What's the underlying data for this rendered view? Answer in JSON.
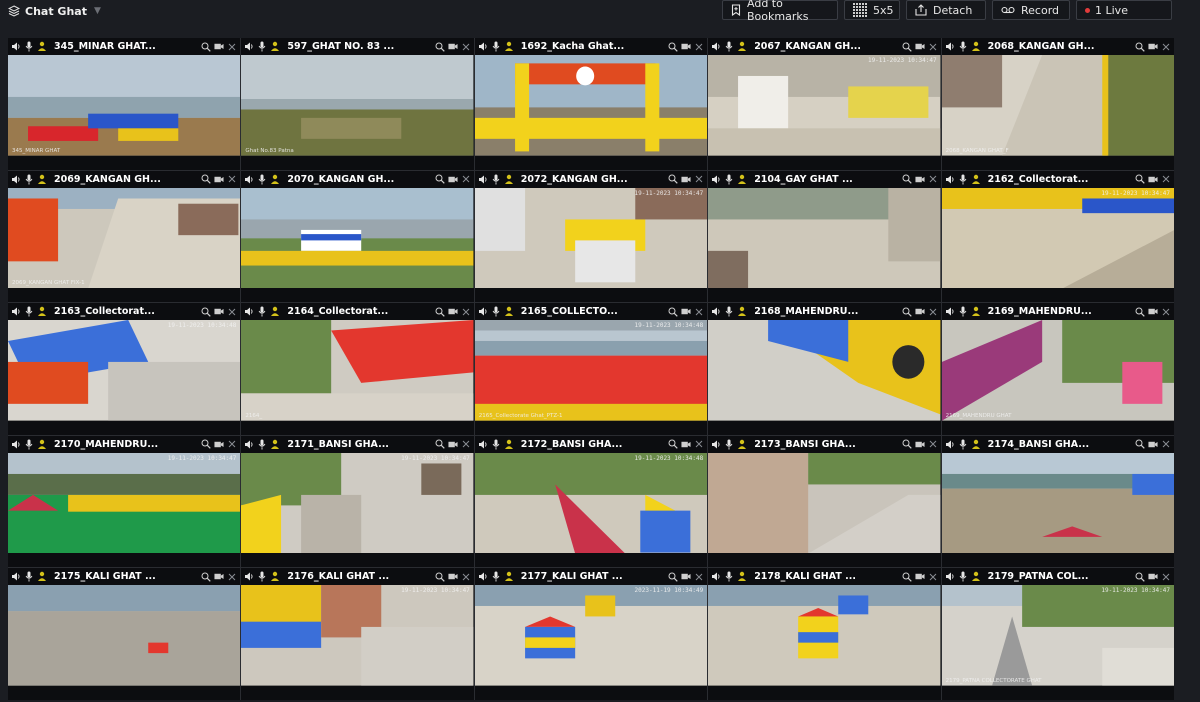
{
  "header": {
    "title": "Chat Ghat",
    "toolbar": {
      "bookmark_label": "Add to Bookmarks",
      "layout_label": "5x5",
      "detach_label": "Detach",
      "record_label": "Record",
      "live_label": "1 Live"
    }
  },
  "colors": {
    "background": "#1b1d22",
    "cell": "#0c0d10",
    "live_dot": "#e23b3b",
    "camera_icon_yellow": "#d4c21a"
  },
  "cameras": [
    {
      "name": "345_MINAR GHAT...",
      "label": "345_MINAR GHAT",
      "ts": ""
    },
    {
      "name": "597_GHAT NO. 83 ...",
      "label": "Ghat No.83 Patna",
      "ts": ""
    },
    {
      "name": "1692_Kacha Ghat...",
      "label": "",
      "ts": ""
    },
    {
      "name": "2067_KANGAN GH...",
      "label": "",
      "ts": "19-11-2023 10:34:47"
    },
    {
      "name": "2068_KANGAN GH...",
      "label": "2068_KANGAN GHAT_F",
      "ts": ""
    },
    {
      "name": "2069_KANGAN GH...",
      "label": "2069_KANGAN GHAT FIX-1",
      "ts": ""
    },
    {
      "name": "2070_KANGAN GH...",
      "label": "",
      "ts": ""
    },
    {
      "name": "2072_KANGAN GH...",
      "label": "",
      "ts": "19-11-2023 10:34:47"
    },
    {
      "name": "2104_GAY GHAT ...",
      "label": "",
      "ts": ""
    },
    {
      "name": "2162_Collectorat...",
      "label": "",
      "ts": "19-11-2023 10:34:47"
    },
    {
      "name": "2163_Collectorat...",
      "label": "",
      "ts": "19-11-2023 10:34:48"
    },
    {
      "name": "2164_Collectorat...",
      "label": "2164_",
      "ts": ""
    },
    {
      "name": "2165_COLLECTO...",
      "label": "2165_Collectorate Ghat_PTZ-1",
      "ts": "19-11-2023 10:34:48"
    },
    {
      "name": "2168_MAHENDRU...",
      "label": "",
      "ts": ""
    },
    {
      "name": "2169_MAHENDRU...",
      "label": "2169_MAHENDRU GHAT",
      "ts": ""
    },
    {
      "name": "2170_MAHENDRU...",
      "label": "",
      "ts": "19-11-2023 10:34:47"
    },
    {
      "name": "2171_BANSI GHA...",
      "label": "",
      "ts": "19-11-2023 10:34:47"
    },
    {
      "name": "2172_BANSI GHA...",
      "label": "",
      "ts": "19-11-2023 10:34:48"
    },
    {
      "name": "2173_BANSI GHA...",
      "label": "",
      "ts": ""
    },
    {
      "name": "2174_BANSI GHA...",
      "label": "",
      "ts": ""
    },
    {
      "name": "2175_KALI GHAT ...",
      "label": "",
      "ts": ""
    },
    {
      "name": "2176_KALI GHAT ...",
      "label": "",
      "ts": "19-11-2023 10:34:47"
    },
    {
      "name": "2177_KALI GHAT ...",
      "label": "",
      "ts": "2023-11-19 10:34:49"
    },
    {
      "name": "2178_KALI GHAT ...",
      "label": "",
      "ts": ""
    },
    {
      "name": "2179_PATNA COL...",
      "label": "2179_PATNA COLLECTORATE GHAT",
      "ts": "19-11-2023 10:34:47"
    }
  ]
}
